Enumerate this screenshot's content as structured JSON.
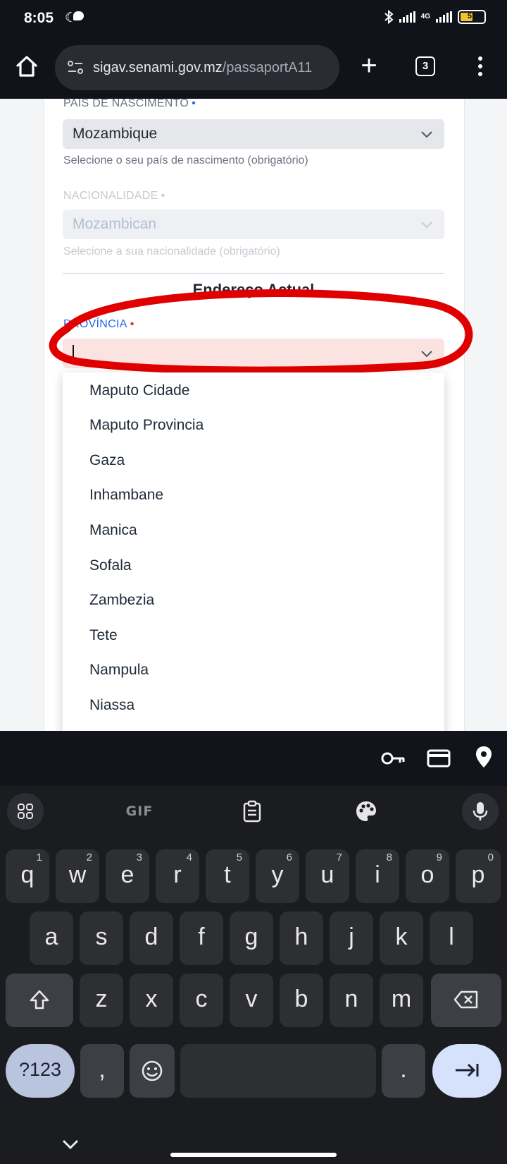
{
  "status_bar": {
    "time": "8:05",
    "network": "4G",
    "battery": "51"
  },
  "browser": {
    "url_host": "sigav.senami.gov.mz",
    "url_path": "/passaportA11",
    "tab_count": "3"
  },
  "form": {
    "birth_country": {
      "label": "PAÍS DE NASCIMENTO",
      "required_mark": "•",
      "value": "Mozambique",
      "hint": "Selecione o seu país de nascimento (obrigatório)"
    },
    "nationality": {
      "label": "NACIONALIDADE",
      "required_mark": "•",
      "value": "Mozambican",
      "hint": "Selecione a sua nacionalidade (obrigatório)"
    },
    "section_title": "Endereço Actual",
    "province": {
      "label": "PROVÍNCIA",
      "required_mark": "•",
      "value": ""
    }
  },
  "dropdown_options": [
    "Maputo Cidade",
    "Maputo Provincia",
    "Gaza",
    "Inhambane",
    "Manica",
    "Sofala",
    "Zambezia",
    "Tete",
    "Nampula",
    "Niassa"
  ],
  "keyboard": {
    "toolbar": {
      "gif_label": "GIF"
    },
    "row1": [
      {
        "k": "q",
        "n": "1"
      },
      {
        "k": "w",
        "n": "2"
      },
      {
        "k": "e",
        "n": "3"
      },
      {
        "k": "r",
        "n": "4"
      },
      {
        "k": "t",
        "n": "5"
      },
      {
        "k": "y",
        "n": "6"
      },
      {
        "k": "u",
        "n": "7"
      },
      {
        "k": "i",
        "n": "8"
      },
      {
        "k": "o",
        "n": "9"
      },
      {
        "k": "p",
        "n": "0"
      }
    ],
    "row2": [
      "a",
      "s",
      "d",
      "f",
      "g",
      "h",
      "j",
      "k",
      "l"
    ],
    "row3": [
      "z",
      "x",
      "c",
      "v",
      "b",
      "n",
      "m"
    ],
    "mode_label": "?123",
    "comma": ",",
    "period": "."
  },
  "colors": {
    "annotation": "#e00000",
    "link_blue": "#2563eb",
    "required_red": "#dc2626"
  }
}
